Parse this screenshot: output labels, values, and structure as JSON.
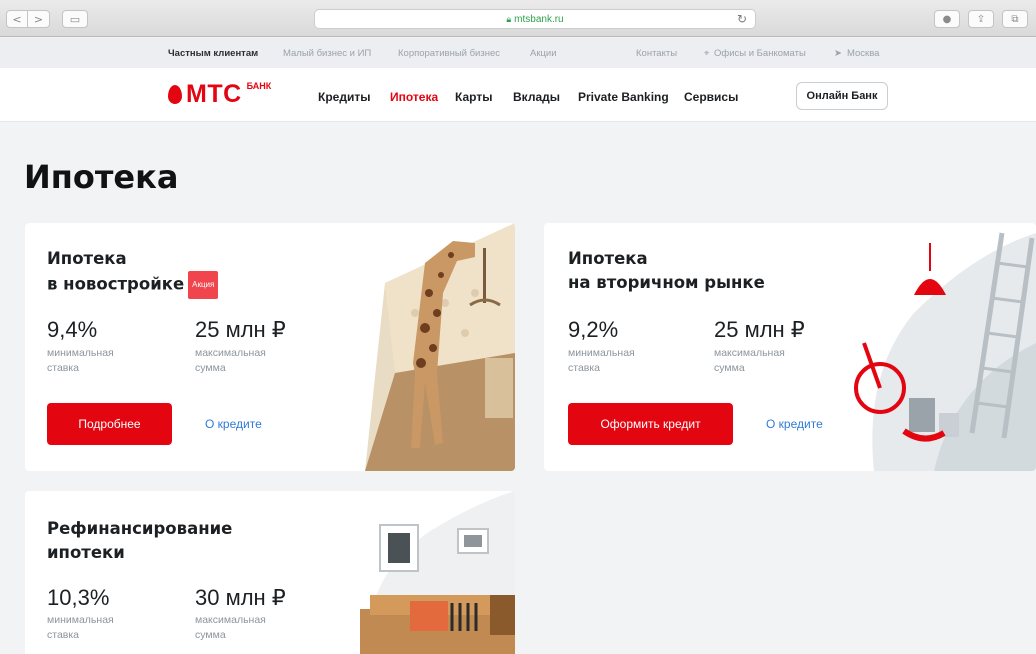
{
  "browser": {
    "url": "mtsbank.ru"
  },
  "topbar": {
    "items": [
      "Частным клиентам",
      "Малый бизнес и ИП",
      "Корпоративный бизнес",
      "Акции",
      "Контакты",
      "Офисы и Банкоматы",
      "Москва"
    ]
  },
  "brand": {
    "logo": "МТС",
    "bank": "БАНК",
    "red": "#e30611"
  },
  "menu": [
    "Кредиты",
    "Ипотека",
    "Карты",
    "Вклады",
    "Private Banking",
    "Сервисы"
  ],
  "online_bank": "Онлайн Банк",
  "page_title": "Ипотека",
  "cards": [
    {
      "title1": "Ипотека",
      "title2": "в новостройке",
      "badge": "Акция",
      "rate": "9,4%",
      "rate_label": "минимальная ставка",
      "sum": "25 млн ₽",
      "sum_label": "максимальная сумма",
      "button": "Подробнее",
      "link": "О кредите"
    },
    {
      "title1": "Ипотека",
      "title2": "на вторичном рынке",
      "rate": "9,2%",
      "rate_label": "минимальная ставка",
      "sum": "25 млн ₽",
      "sum_label": "максимальная сумма",
      "button": "Оформить кредит",
      "link": "О кредите"
    },
    {
      "title1": "Рефинансирование",
      "title2": "ипотеки",
      "rate": "10,3%",
      "rate_label": "минимальная ставка",
      "sum": "30 млн ₽",
      "sum_label": "максимальная сумма"
    }
  ]
}
